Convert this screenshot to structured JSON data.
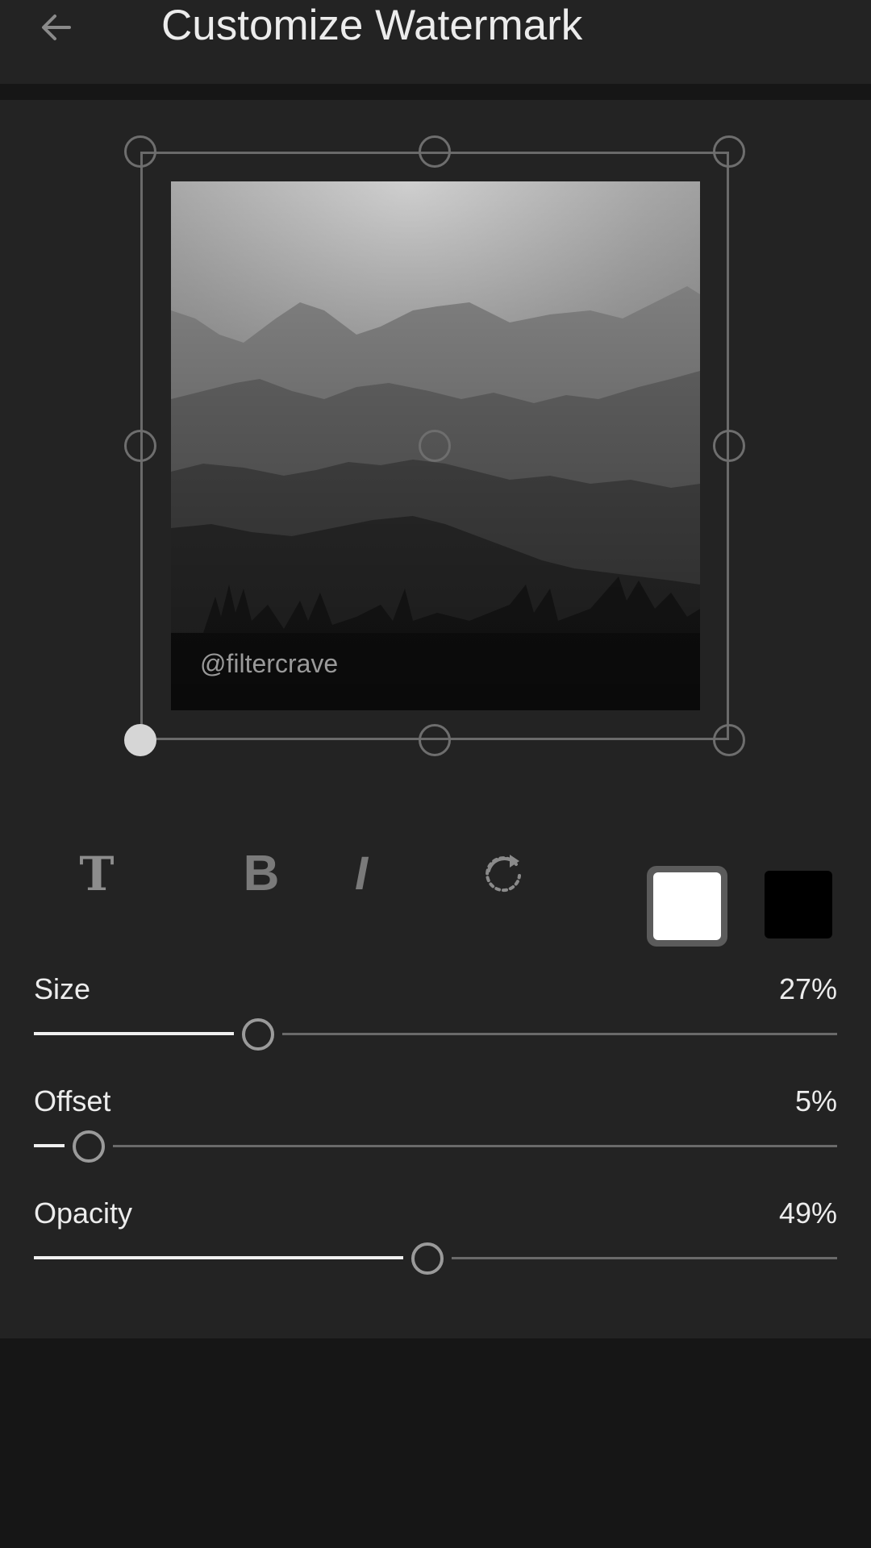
{
  "header": {
    "title": "Customize Watermark",
    "back_icon": "arrow-left-icon"
  },
  "preview": {
    "watermark_text": "@filtercrave",
    "image_description_icon": "photo"
  },
  "toolbar": {
    "text_glyph": "T",
    "bold_glyph": "B",
    "italic_glyph": "I",
    "rotate_icon": "rotate-icon",
    "colors": [
      "#ffffff",
      "#000000"
    ],
    "selected_color": "#ffffff"
  },
  "sliders": [
    {
      "label": "Size",
      "value_text": "27%",
      "value": 0.27
    },
    {
      "label": "Offset",
      "value_text": "5%",
      "value": 0.05
    },
    {
      "label": "Opacity",
      "value_text": "49%",
      "value": 0.49
    }
  ]
}
